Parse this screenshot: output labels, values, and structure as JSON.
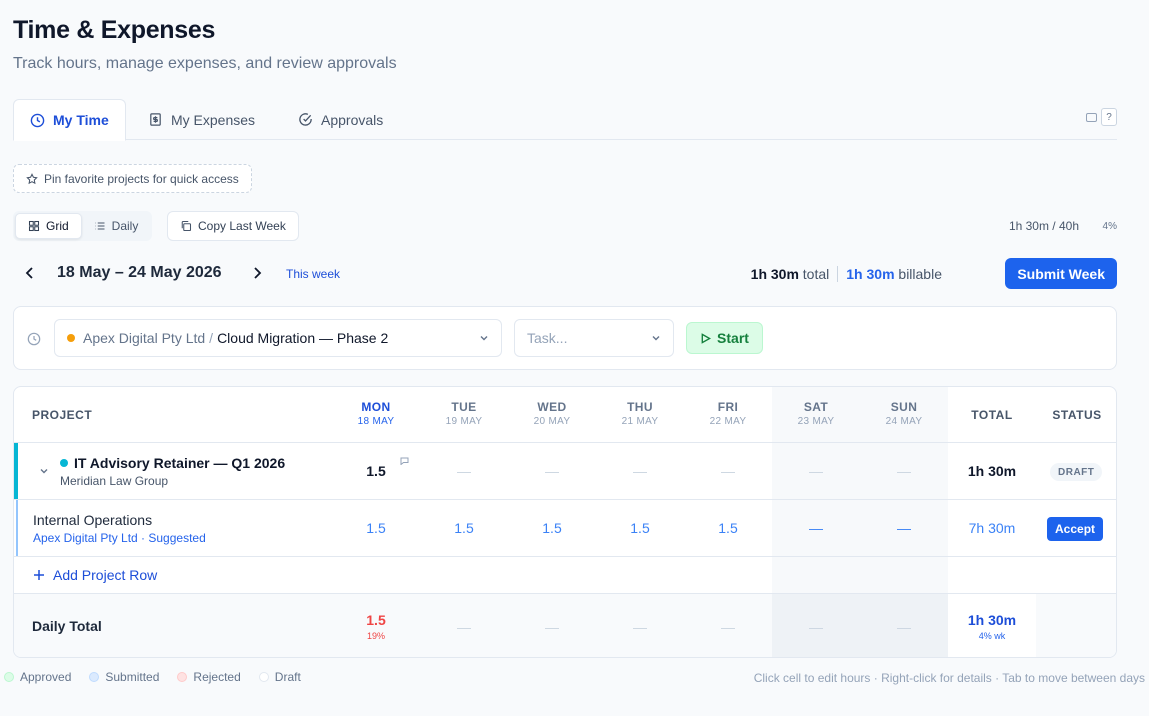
{
  "header": {
    "title": "Time & Expenses",
    "subtitle": "Track hours, manage expenses, and review approvals"
  },
  "tabs": [
    {
      "label": "My Time",
      "icon": "clock-icon",
      "active": true
    },
    {
      "label": "My Expenses",
      "icon": "receipt-icon",
      "active": false
    },
    {
      "label": "Approvals",
      "icon": "check-circle-icon",
      "active": false
    }
  ],
  "help_key": "?",
  "pin_prompt": "Pin favorite projects for quick access",
  "view_toggle": {
    "grid": "Grid",
    "daily": "Daily",
    "active": "Grid"
  },
  "copy_last_week": "Copy Last Week",
  "week_progress": {
    "text": "1h 30m / 40h",
    "percent_label": "4%"
  },
  "week_nav": {
    "range": "18 May – 24 May 2026",
    "this_week": "This week"
  },
  "summary": {
    "total_value": "1h 30m",
    "total_label": "total",
    "billable_value": "1h 30m",
    "billable_label": "billable"
  },
  "submit_label": "Submit Week",
  "timer": {
    "client": "Apex Digital Pty Ltd",
    "separator": "/",
    "project": "Cloud Migration — Phase 2",
    "task_placeholder": "Task...",
    "start_label": "Start",
    "client_color": "#f59e0b"
  },
  "grid": {
    "project_header": "PROJECT",
    "total_header": "TOTAL",
    "status_header": "STATUS",
    "days": [
      {
        "name": "MON",
        "date": "18 MAY",
        "today": true
      },
      {
        "name": "TUE",
        "date": "19 MAY",
        "today": false
      },
      {
        "name": "WED",
        "date": "20 MAY",
        "today": false
      },
      {
        "name": "THU",
        "date": "21 MAY",
        "today": false
      },
      {
        "name": "FRI",
        "date": "22 MAY",
        "today": false
      },
      {
        "name": "SAT",
        "date": "23 MAY",
        "today": false
      },
      {
        "name": "SUN",
        "date": "24 MAY",
        "today": false
      }
    ],
    "rows": [
      {
        "project": "IT Advisory Retainer — Q1 2026",
        "client": "Meridian Law Group",
        "cells": [
          "1.5",
          "—",
          "—",
          "—",
          "—",
          "—",
          "—"
        ],
        "total": "1h 30m",
        "status": "DRAFT",
        "color": "#06b6d4"
      },
      {
        "project": "Internal Operations",
        "client": "Apex Digital Pty Ltd · Suggested",
        "cells": [
          "1.5",
          "1.5",
          "1.5",
          "1.5",
          "1.5",
          "—",
          "—"
        ],
        "total": "7h 30m",
        "action": "Accept"
      }
    ],
    "add_row_label": "Add Project Row",
    "daily_total": {
      "label": "Daily Total",
      "mon_value": "1.5",
      "mon_pct": "19%",
      "others": [
        "—",
        "—",
        "—",
        "—",
        "—",
        "—"
      ],
      "total": "1h 30m",
      "total_sub": "4% wk"
    }
  },
  "legend": [
    {
      "label": "Approved",
      "color": "#dcfce7"
    },
    {
      "label": "Submitted",
      "color": "#dbeafe"
    },
    {
      "label": "Rejected",
      "color": "#fee2e2"
    },
    {
      "label": "Draft",
      "color": "#ffffff"
    }
  ],
  "hint": "Click cell to edit hours · Right-click for details · Tab to move between days"
}
